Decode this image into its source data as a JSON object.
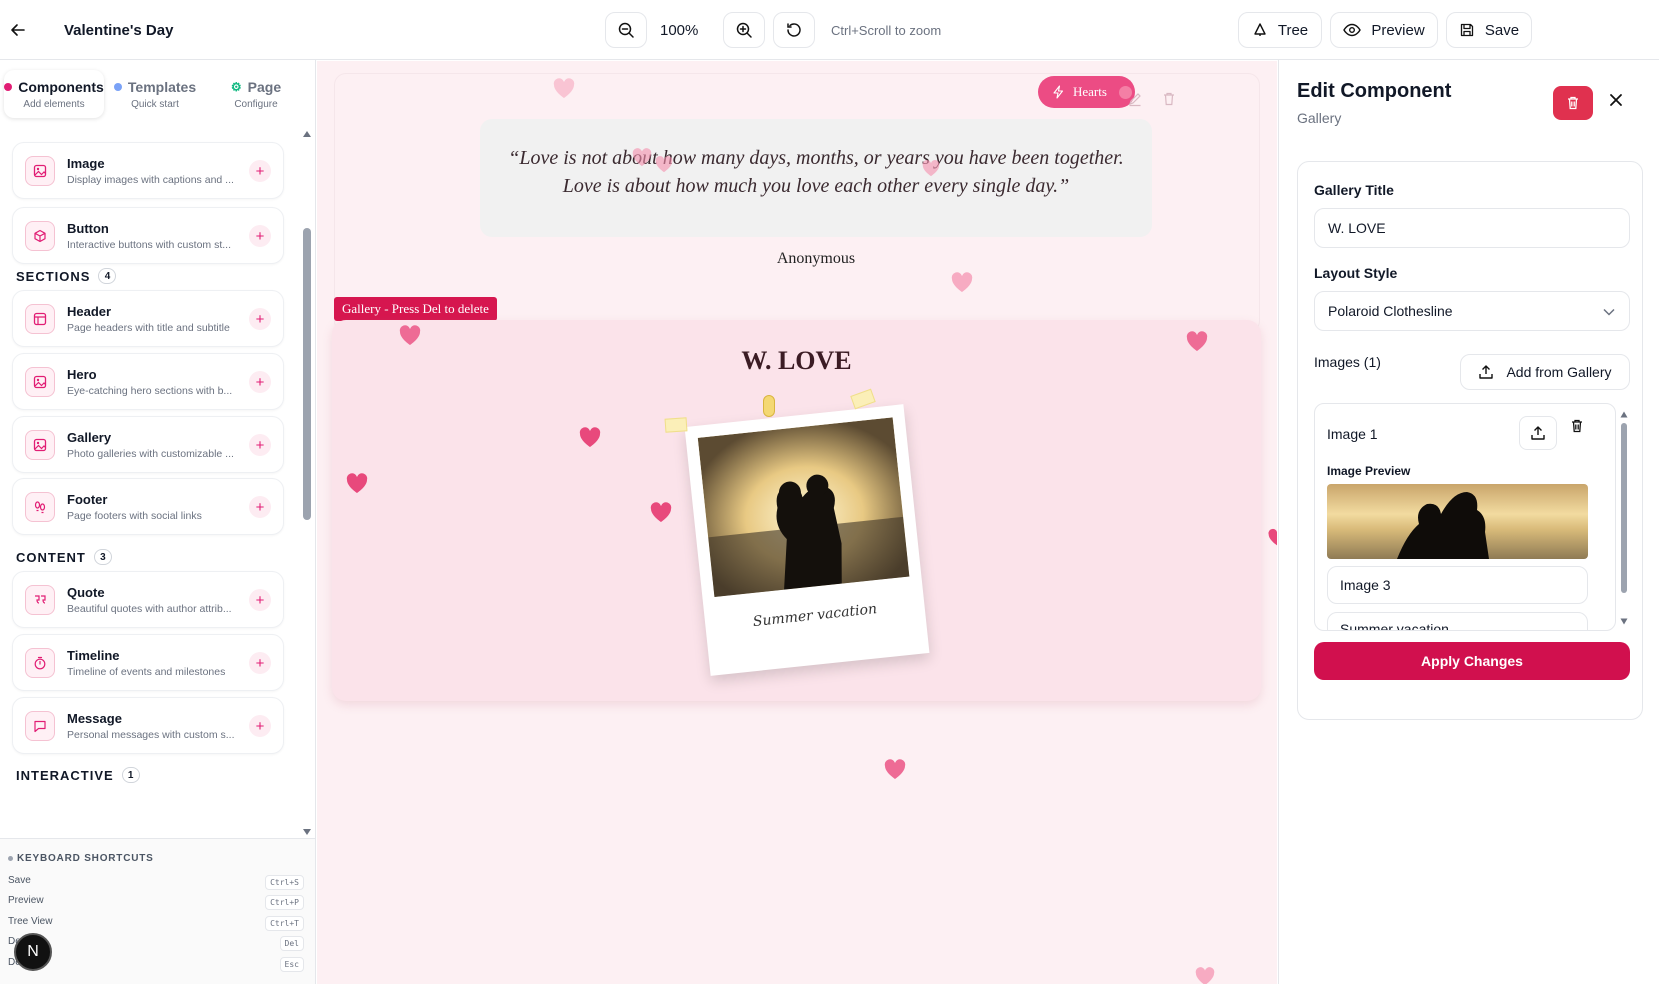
{
  "header": {
    "page_title": "Valentine's Day",
    "zoom_level": "100%",
    "zoom_hint": "Ctrl+Scroll to zoom",
    "tree_label": "Tree",
    "preview_label": "Preview",
    "save_label": "Save"
  },
  "left": {
    "tabs": [
      {
        "title": "Components",
        "subtitle": "Add elements",
        "color": "#e11d74"
      },
      {
        "title": "Templates",
        "subtitle": "Quick start",
        "color": "#7aa2f7"
      },
      {
        "title": "Page",
        "subtitle": "Configure",
        "color": "#10b981"
      }
    ],
    "basic_items": [
      {
        "name": "Image",
        "desc": "Display images with captions and ...",
        "icon": "image-icon"
      },
      {
        "name": "Button",
        "desc": "Interactive buttons with custom st...",
        "icon": "cube-icon"
      }
    ],
    "sections": {
      "title": "SECTIONS",
      "count": "4",
      "items": [
        {
          "name": "Header",
          "desc": "Page headers with title and subtitle",
          "icon": "layout-icon"
        },
        {
          "name": "Hero",
          "desc": "Eye-catching hero sections with b...",
          "icon": "image-icon"
        },
        {
          "name": "Gallery",
          "desc": "Photo galleries with customizable ...",
          "icon": "image-icon"
        },
        {
          "name": "Footer",
          "desc": "Page footers with social links",
          "icon": "footprints-icon"
        }
      ]
    },
    "content": {
      "title": "CONTENT",
      "count": "3",
      "items": [
        {
          "name": "Quote",
          "desc": "Beautiful quotes with author attrib...",
          "icon": "quote-icon"
        },
        {
          "name": "Timeline",
          "desc": "Timeline of events and milestones",
          "icon": "timer-icon"
        },
        {
          "name": "Message",
          "desc": "Personal messages with custom s...",
          "icon": "message-icon"
        }
      ]
    },
    "interactive": {
      "title": "INTERACTIVE",
      "count": "1"
    },
    "shortcuts": {
      "title": "KEYBOARD SHORTCUTS",
      "rows": [
        {
          "label": "Save",
          "key": "Ctrl+S"
        },
        {
          "label": "Preview",
          "key": "Ctrl+P"
        },
        {
          "label": "Tree View",
          "key": "Ctrl+T"
        },
        {
          "label": "De",
          "key": "Del"
        },
        {
          "label": "Deselect",
          "key": "Esc"
        }
      ]
    },
    "badge_letter": "N"
  },
  "canvas": {
    "hearts_label": "Hearts",
    "quote_line1": "“Love is not about how many days, months, or years you have been together.",
    "quote_line2": "Love is about how much you love each other every single day.”",
    "quote_author": "Anonymous",
    "selection_label": "Gallery - Press Del to delete",
    "gallery_title": "W. LOVE",
    "photo_caption": "Summer vacation"
  },
  "panel": {
    "title": "Edit Component",
    "subtitle": "Gallery",
    "gallery_title_label": "Gallery Title",
    "gallery_title_value": "W. LOVE",
    "layout_label": "Layout Style",
    "layout_value": "Polaroid Clothesline",
    "images_label": "Images (1)",
    "add_from_gallery": "Add from Gallery",
    "image_name": "Image 1",
    "image_preview_label": "Image Preview",
    "image_alt_value": "Image 3",
    "image_caption_value": "Summer vacation",
    "apply_label": "Apply Changes"
  },
  "colors": {
    "accent": "#d1104e",
    "danger": "#e0314f",
    "canvas_bg": "#fdf0f3",
    "gallery_bg": "#fbe3ea"
  }
}
